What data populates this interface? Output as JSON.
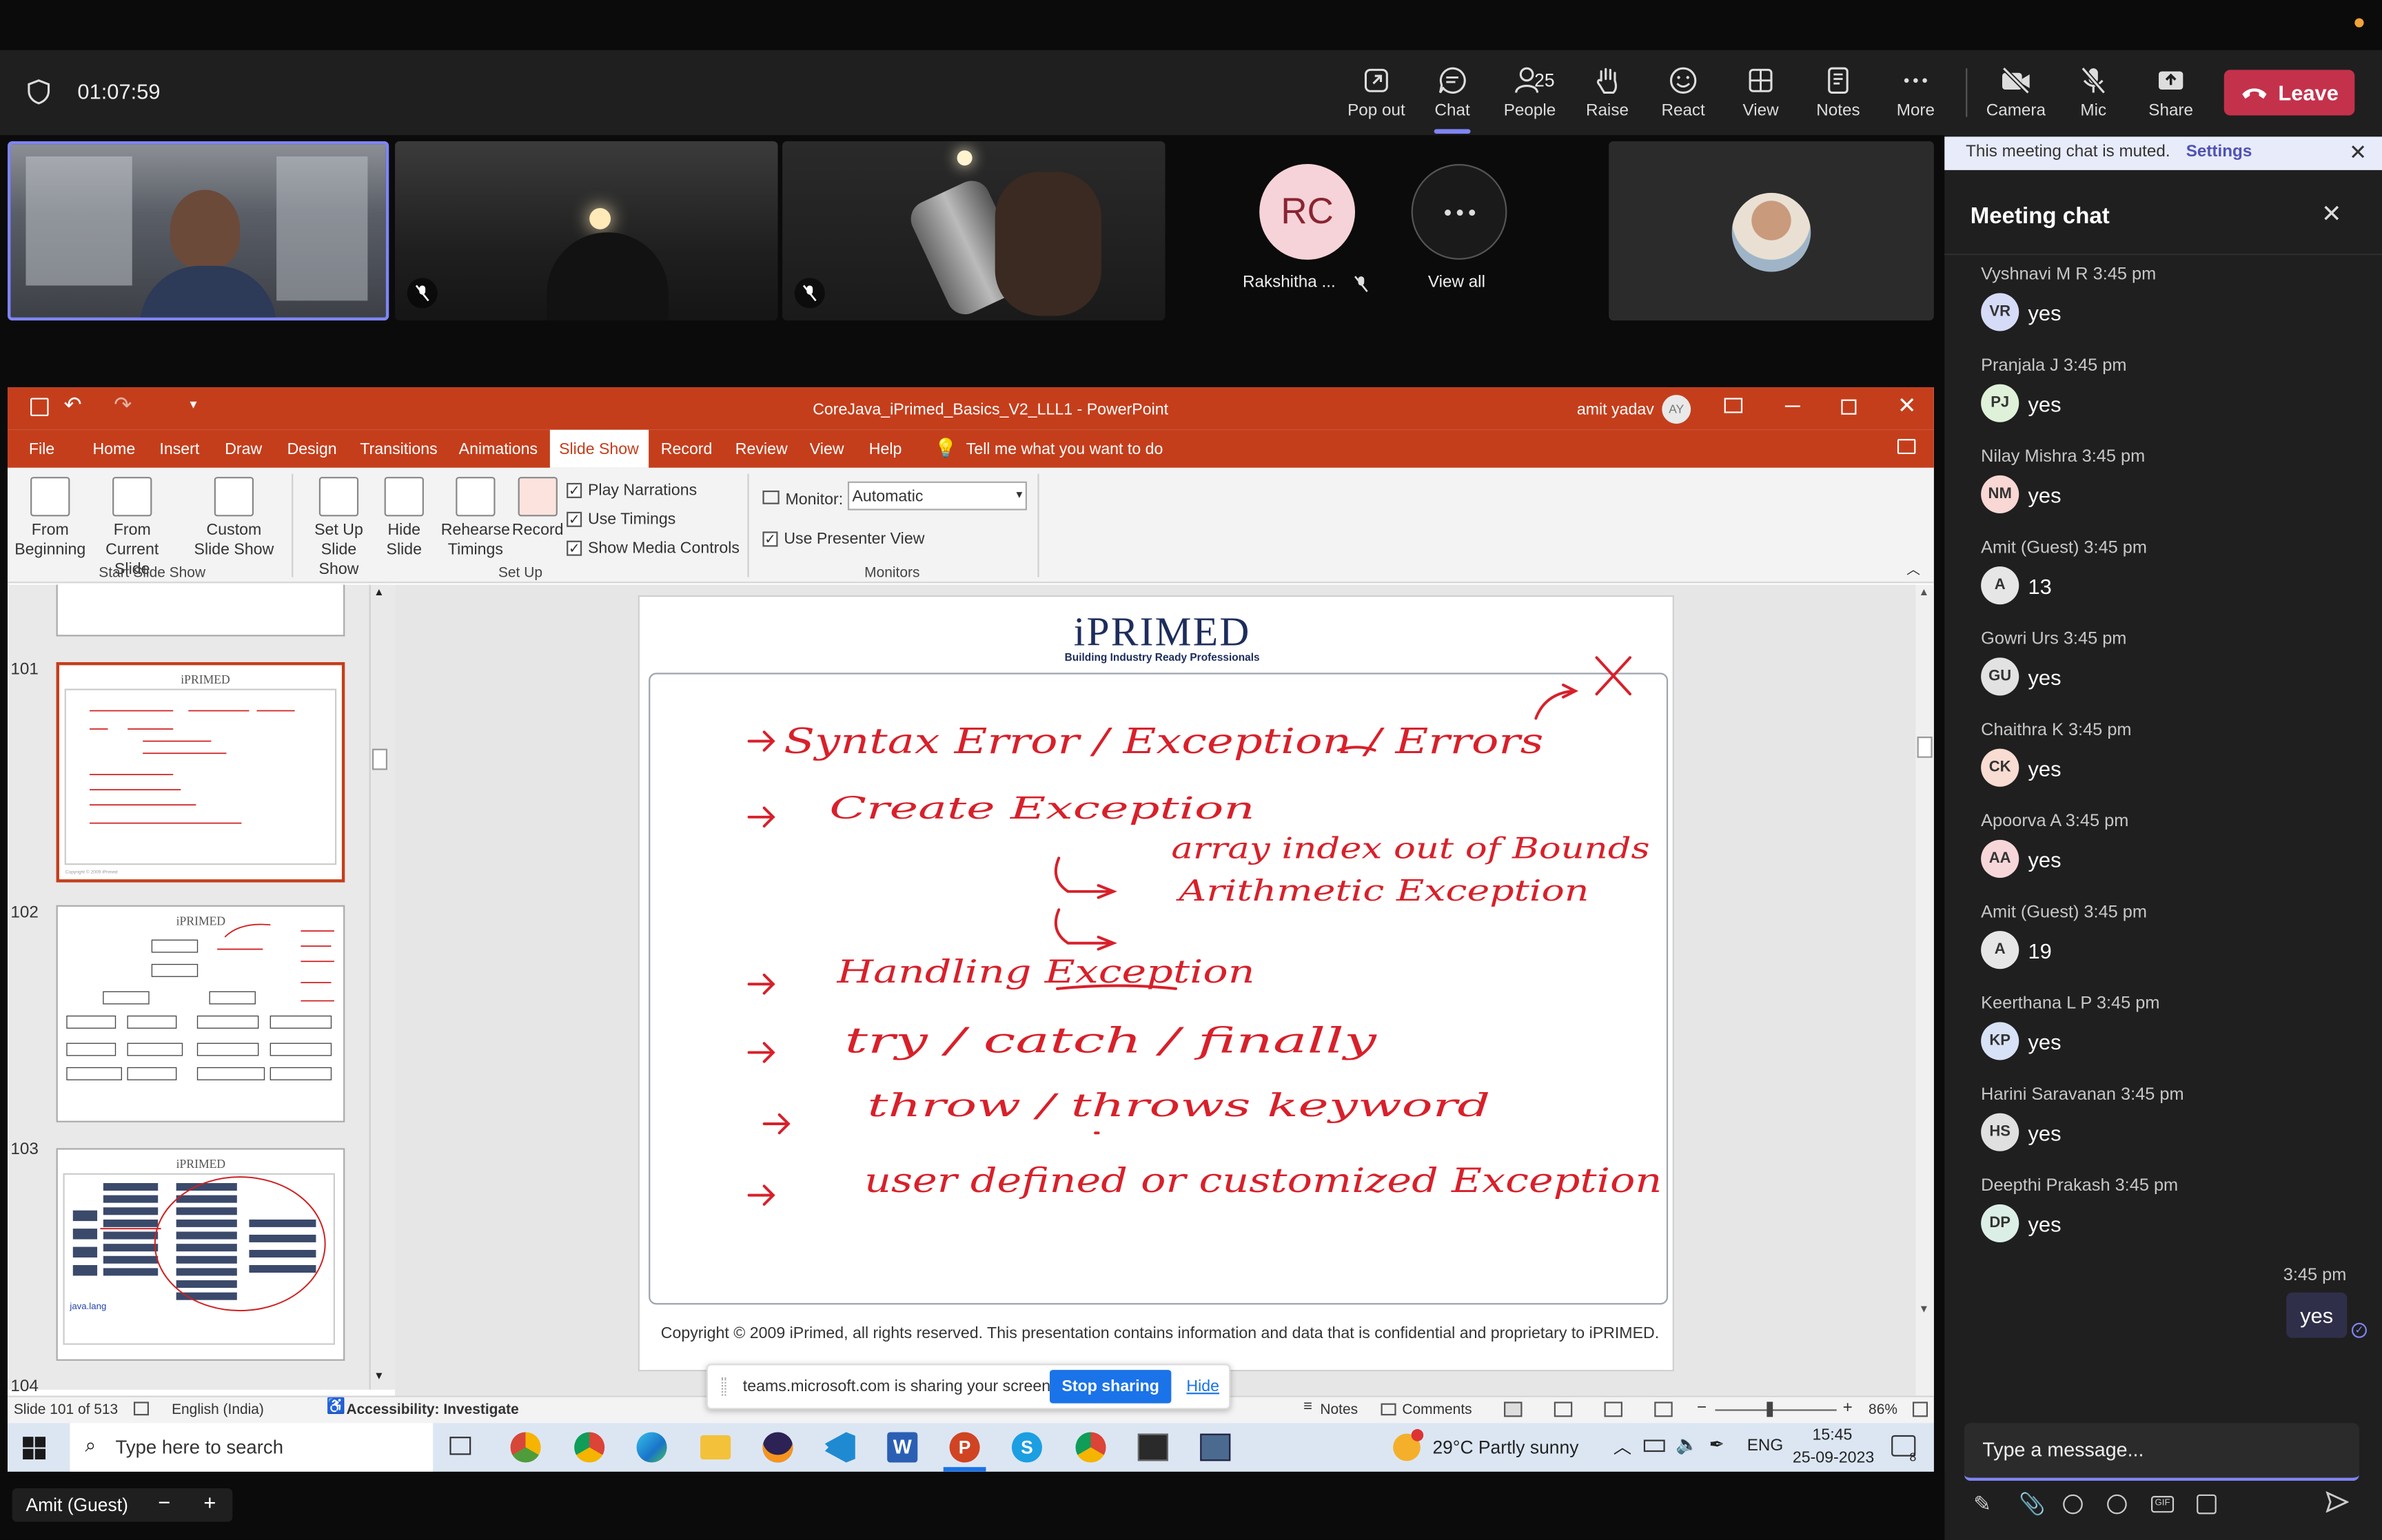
{
  "meeting": {
    "timer": "01:07:59"
  },
  "toolbar": {
    "popout": "Pop out",
    "chat": "Chat",
    "people": "People",
    "people_count": "25",
    "raise": "Raise",
    "react": "React",
    "view": "View",
    "notes": "Notes",
    "more": "More",
    "camera": "Camera",
    "mic": "Mic",
    "share": "Share",
    "leave": "Leave"
  },
  "participants": {
    "rc_initials": "RC",
    "rc_name": "Rakshitha ...",
    "view_all": "View all"
  },
  "ppt": {
    "window_title": "CoreJava_iPrimed_Basics_V2_LLL1  -  PowerPoint",
    "user_name": "amit yadav",
    "user_initials": "AY",
    "tabs": [
      "File",
      "Home",
      "Insert",
      "Draw",
      "Design",
      "Transitions",
      "Animations",
      "Slide Show",
      "Record",
      "Review",
      "View",
      "Help"
    ],
    "tell_me": "Tell me what you want to do",
    "ribbon": {
      "from_beginning": "From Beginning",
      "from_current": "From Current Slide",
      "custom_show": "Custom Slide Show",
      "group_start": "Start Slide Show",
      "set_up": "Set Up Slide Show",
      "hide_slide": "Hide Slide",
      "rehearse": "Rehearse Timings",
      "record": "Record",
      "play_narrations": "Play Narrations",
      "use_timings": "Use Timings",
      "show_media": "Show Media Controls",
      "group_setup": "Set Up",
      "monitor_label": "Monitor:",
      "monitor_value": "Automatic",
      "presenter_view": "Use Presenter View",
      "group_monitors": "Monitors"
    },
    "thumb_numbers": [
      "101",
      "102",
      "103",
      "104"
    ],
    "slide": {
      "logo": "iPRIMED",
      "logo_sub": "Building Industry Ready Professionals",
      "lines": [
        "Syntax Error / Exception / Errors",
        "Create    Exception",
        "array index out of Bounds",
        "Arithmetic Exception",
        "Handling Exception",
        "try / catch / finally",
        "throw / throws keyword",
        "user defined or customized Exception"
      ],
      "footer": "Copyright © 2009 iPrimed, all rights reserved. This presentation contains information  and data  that is confidential and proprietary to iPRIMED."
    },
    "status": {
      "slide_of": "Slide 101 of 513",
      "language": "English (India)",
      "accessibility": "Accessibility: Investigate",
      "notes": "Notes",
      "comments": "Comments",
      "zoom": "86%"
    },
    "share_bar": {
      "text": "teams.microsoft.com is sharing your screen.",
      "stop": "Stop sharing",
      "hide": "Hide"
    },
    "taskbar": {
      "search_placeholder": "Type here to search",
      "weather": "29°C  Partly sunny",
      "lang": "ENG",
      "time": "15:45",
      "date": "25-09-2023",
      "notif_count": "8"
    }
  },
  "chat": {
    "muted_text": "This meeting chat is muted.",
    "settings": "Settings",
    "title": "Meeting chat",
    "messages": [
      {
        "who": "Vyshnavi M R  3:45 pm",
        "initials": "VR",
        "text": "yes",
        "color": "#d6dcf7"
      },
      {
        "who": "Pranjala J  3:45 pm",
        "initials": "PJ",
        "text": "yes",
        "color": "#dff1d8"
      },
      {
        "who": "Nilay Mishra  3:45 pm",
        "initials": "NM",
        "text": "yes",
        "color": "#f8d7d4"
      },
      {
        "who": "Amit (Guest)  3:45 pm",
        "initials": "A",
        "text": "13",
        "color": "#e6e6e6"
      },
      {
        "who": "Gowri Urs  3:45 pm",
        "initials": "GU",
        "text": "yes",
        "color": "#e2e2e2"
      },
      {
        "who": "Chaithra K  3:45 pm",
        "initials": "CK",
        "text": "yes",
        "color": "#f9dcd2"
      },
      {
        "who": "Apoorva A  3:45 pm",
        "initials": "AA",
        "text": "yes",
        "color": "#f7d6da"
      },
      {
        "who": "Amit (Guest)  3:45 pm",
        "initials": "A",
        "text": "19",
        "color": "#e6e6e6"
      },
      {
        "who": "Keerthana L P  3:45 pm",
        "initials": "KP",
        "text": "yes",
        "color": "#d8e2f6"
      },
      {
        "who": "Harini Saravanan  3:45 pm",
        "initials": "HS",
        "text": "yes",
        "color": "#e0e0e0"
      },
      {
        "who": "Deepthi Prakash  3:45 pm",
        "initials": "DP",
        "text": "yes",
        "color": "#dcefe7"
      }
    ],
    "own_time": "3:45 pm",
    "own_text": "yes",
    "input_placeholder": "Type a message..."
  },
  "bottom": {
    "speaker": "Amit (Guest)"
  }
}
